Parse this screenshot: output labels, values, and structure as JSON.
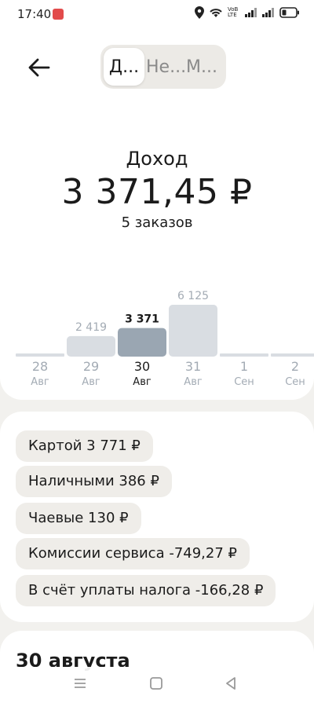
{
  "status": {
    "time": "17:40",
    "network_label": "VoB LTE",
    "icons": [
      "notification-app-icon",
      "location-icon",
      "wifi-icon",
      "signal-icon",
      "signal-icon",
      "battery-icon"
    ]
  },
  "header": {
    "back_icon": "arrow-left-icon",
    "tabs": [
      {
        "label": "Д...",
        "active": true
      },
      {
        "label": "Не...М...",
        "active": false
      }
    ]
  },
  "summary": {
    "title": "Доход",
    "amount": "3 371,45 ₽",
    "orders": "5 заказов"
  },
  "chart_data": {
    "type": "bar",
    "categories": [
      "28 Авг",
      "29 Авг",
      "30 Авг",
      "31 Авг",
      "1 Сен",
      "2 Сен"
    ],
    "days": [
      "28",
      "29",
      "30",
      "31",
      "1",
      "2"
    ],
    "months": [
      "Авг",
      "Авг",
      "Авг",
      "Авг",
      "Сен",
      "Сен"
    ],
    "values": [
      0,
      2419,
      3371,
      6125,
      0,
      0
    ],
    "value_labels": [
      "",
      "2 419",
      "3 371",
      "6 125",
      "",
      ""
    ],
    "selected_index": 2,
    "ylim": [
      0,
      6125
    ],
    "colors": {
      "bar": "#d9dde2",
      "selected_bar": "#9aa6b2",
      "label": "#a3abb4",
      "selected_label": "#1b1b1b"
    }
  },
  "breakdown": {
    "chips": [
      "Картой 3 771 ₽",
      "Наличными 386 ₽",
      "Чаевые 130 ₽",
      "Комиссии сервиса -749,27 ₽",
      "В счёт уплаты налога -166,28 ₽"
    ]
  },
  "day_section": {
    "title": "30 августа"
  },
  "nav": {
    "icons": [
      "menu-icon",
      "home-icon",
      "back-icon"
    ]
  }
}
